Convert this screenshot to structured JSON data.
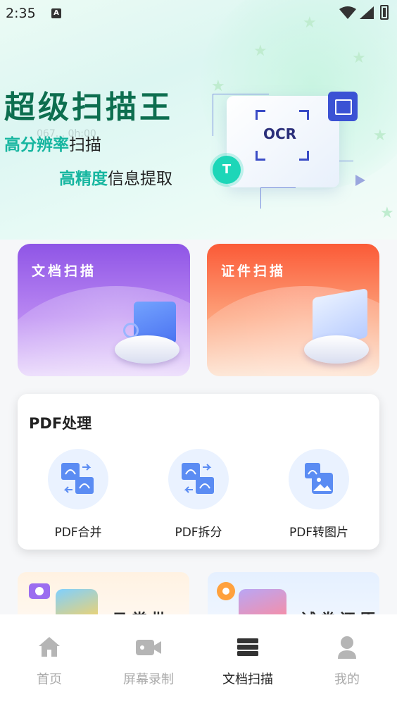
{
  "status_bar": {
    "time": "2:35",
    "notif_icon": "A"
  },
  "hero": {
    "title": "超级扫描王",
    "line1_highlight": "高分辨率",
    "line1_rest": "扫描",
    "line2_highlight": "高精度",
    "line2_rest": "信息提取",
    "ghost_text": "067... 0h:00",
    "ocr_label": "OCR",
    "t_badge": "T"
  },
  "scan_cards": [
    {
      "label": "文档扫描",
      "icon": "document-scan-icon"
    },
    {
      "label": "证件扫描",
      "icon": "id-card-scan-icon"
    }
  ],
  "pdf_section": {
    "title": "PDF处理",
    "items": [
      {
        "label": "PDF合并",
        "icon": "pdf-merge-icon"
      },
      {
        "label": "PDF拆分",
        "icon": "pdf-split-icon"
      },
      {
        "label": "PDF转图片",
        "icon": "pdf-to-image-icon"
      }
    ]
  },
  "peek_cards": [
    {
      "label": "日常批改",
      "icon": "camera-icon"
    },
    {
      "label": "试卷还原",
      "icon": "paint-icon"
    }
  ],
  "tabbar": {
    "items": [
      {
        "label": "首页",
        "icon": "home-icon",
        "active": false
      },
      {
        "label": "屏幕录制",
        "icon": "video-camera-icon",
        "active": false
      },
      {
        "label": "文档扫描",
        "icon": "stack-icon",
        "active": true
      },
      {
        "label": "我的",
        "icon": "user-icon",
        "active": false
      }
    ]
  },
  "colors": {
    "accent": "#17b6a0",
    "title_green": "#0d6e4f",
    "doc_card": "#8f55e6",
    "id_card": "#fb5a37",
    "icon_blue": "#4a7cf0"
  }
}
